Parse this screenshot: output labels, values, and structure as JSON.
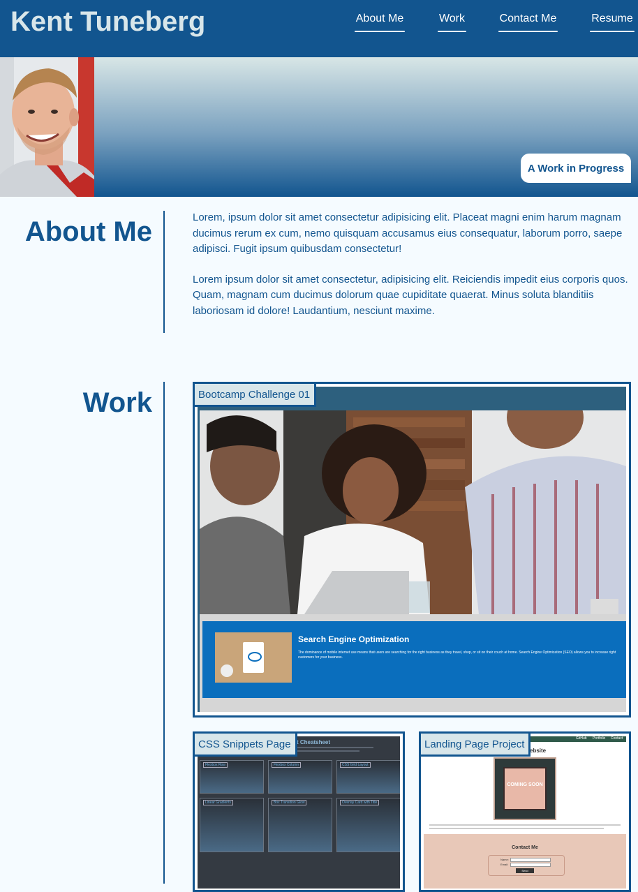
{
  "header": {
    "site_title": "Kent Tuneberg",
    "nav": [
      {
        "label": "About Me"
      },
      {
        "label": "Work"
      },
      {
        "label": "Contact Me"
      },
      {
        "label": "Resume"
      }
    ]
  },
  "hero": {
    "tagline": "A Work in Progress"
  },
  "about": {
    "heading": "About Me",
    "paragraphs": [
      "Lorem, ipsum dolor sit amet consectetur adipisicing elit. Placeat magni enim harum magnam ducimus rerum ex cum, nemo quisquam accusamus eius consequatur, laborum porro, saepe adipisci. Fugit ipsum quibusdam consectetur!",
      "Lorem ipsum dolor sit amet consectetur, adipisicing elit. Reiciendis impedit eius corporis quos. Quam, magnam cum ducimus dolorum quae cupiditate quaerat. Minus soluta blanditiis laboriosam id dolore! Laudantium, nesciunt maxime."
    ]
  },
  "work": {
    "heading": "Work",
    "projects": [
      {
        "title": "Bootcamp Challenge 01",
        "screenshot": {
          "banner_title": "Search Engine Optimization",
          "banner_text": "The dominance of mobile internet use means that users are searching for the right business as they travel, shop, or sit on their couch at home. Search Engine Optimization (SEO) allows you to increase right customers for your business."
        }
      },
      {
        "title": "CSS Snippets Page",
        "screenshot": {
          "header_text": "t Cheatsheet",
          "cells": [
            "Flexbox Row",
            "Flexbox Column",
            "CSS Grid Layout",
            "Linear Gradients",
            "Box Transition Glow",
            "Overlay Card with Title"
          ]
        }
      },
      {
        "title": "Landing Page Project",
        "screenshot": {
          "nav": [
            "GitHub",
            "Portfolio",
            "Contact"
          ],
          "header_text": "ebsite",
          "coming_soon": "COMING SOON",
          "contact_title": "Contact Me",
          "name_label": "Name:",
          "email_label": "Email:",
          "send_label": "Send"
        }
      }
    ]
  },
  "colors": {
    "primary": "#12558f",
    "label_bg": "#d8e6ea",
    "page_bg": "#f5fbff"
  }
}
